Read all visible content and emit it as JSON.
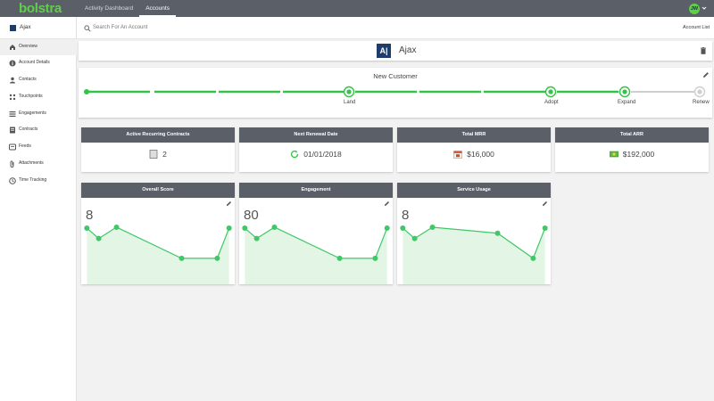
{
  "app": {
    "logo": "bolstra",
    "nav_tabs": [
      {
        "label": "Activity Dashboard",
        "active": false
      },
      {
        "label": "Accounts",
        "active": true
      }
    ],
    "user_initials": "JW"
  },
  "search": {
    "placeholder": "Search For An Account",
    "account_list_label": "Account List"
  },
  "sidebar": {
    "account_name": "Ajax",
    "items": [
      {
        "label": "Overview",
        "icon": "home-icon",
        "active": true
      },
      {
        "label": "Account Details",
        "icon": "info-icon",
        "active": false
      },
      {
        "label": "Contacts",
        "icon": "person-icon",
        "active": false
      },
      {
        "label": "Touchpoints",
        "icon": "touchpoints-icon",
        "active": false
      },
      {
        "label": "Engagements",
        "icon": "list-icon",
        "active": false
      },
      {
        "label": "Contracts",
        "icon": "document-icon",
        "active": false
      },
      {
        "label": "Feeds",
        "icon": "feed-icon",
        "active": false
      },
      {
        "label": "Attachments",
        "icon": "paperclip-icon",
        "active": false
      },
      {
        "label": "Time Tracking",
        "icon": "clock-icon",
        "active": false
      }
    ]
  },
  "account_header": {
    "logo_text": "A|",
    "name": "Ajax"
  },
  "lifecycle": {
    "title": "New Customer",
    "stages": [
      {
        "label": "Land",
        "completed": true
      },
      {
        "label": "Adopt",
        "completed": true
      },
      {
        "label": "Expand",
        "completed": true
      },
      {
        "label": "Renew",
        "completed": false
      }
    ]
  },
  "metrics": [
    {
      "title": "Active Recurring Contracts",
      "value": "2",
      "icon": "contract-icon"
    },
    {
      "title": "Next Renewal Date",
      "value": "01/01/2018",
      "icon": "refresh-icon"
    },
    {
      "title": "Total MRR",
      "value": "$16,000",
      "icon": "calendar-icon"
    },
    {
      "title": "Total ARR",
      "value": "$192,000",
      "icon": "money-icon"
    }
  ],
  "scores": [
    {
      "title": "Overall Score",
      "value": "8",
      "trend": [
        6.5,
        5.3,
        6.6,
        3,
        3,
        6.5
      ]
    },
    {
      "title": "Engagement",
      "value": "80",
      "trend": [
        6.5,
        5.3,
        6.6,
        3,
        3,
        6.5
      ]
    },
    {
      "title": "Service Usage",
      "value": "8",
      "trend": [
        6.5,
        5.3,
        6.6,
        5.9,
        3,
        6.5
      ]
    }
  ],
  "colors": {
    "accent_green": "#33c348",
    "header_gray": "#5b5f68",
    "navy": "#1f3d6b"
  }
}
